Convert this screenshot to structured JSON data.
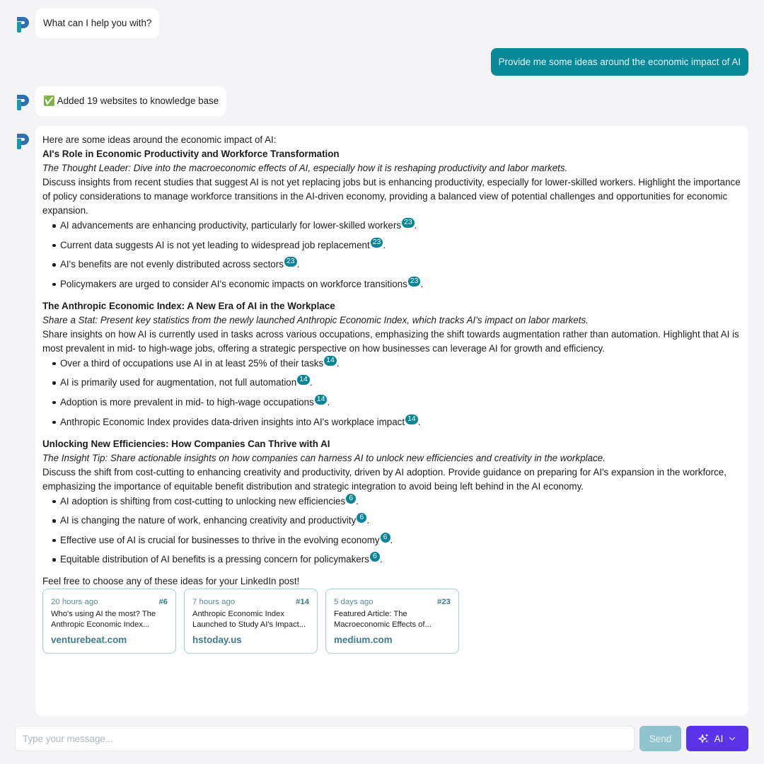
{
  "colors": {
    "background": "#f4f4f6",
    "user_bubble": "#08899a",
    "citation_badge": "#0a8496",
    "send_button": "#8fc3cd",
    "ai_button": "#5b34ea",
    "source_border": "#a9cdd5"
  },
  "assistant": {
    "avatar_icon": "p-logo-icon"
  },
  "messages": {
    "greeting": "What can I help you with?",
    "user_prompt": "Provide me some ideas around the economic impact of AI",
    "status": "✅ Added 19 websites to knowledge base",
    "response": {
      "intro": "Here are some ideas around the economic impact of AI:",
      "sections": [
        {
          "title": "AI's Role in Economic Productivity and Workforce Transformation",
          "italic": "The Thought Leader: Dive into the macroeconomic effects of AI, especially how it is reshaping productivity and labor markets.",
          "description": "Discuss insights from recent studies that suggest AI is not yet replacing jobs but is enhancing productivity, especially for lower-skilled workers. Highlight the importance of policy considerations to manage workforce transitions in the AI-driven economy, providing a balanced view of potential challenges and opportunities for economic expansion.",
          "points": [
            {
              "text": "AI advancements are enhancing productivity, particularly for lower-skilled workers",
              "cite": "23"
            },
            {
              "text": "Current data suggests AI is not yet leading to widespread job replacement",
              "cite": "23"
            },
            {
              "text": "AI's benefits are not evenly distributed across sectors",
              "cite": "23"
            },
            {
              "text": "Policymakers are urged to consider AI's economic impacts on workforce transitions",
              "cite": "23"
            }
          ]
        },
        {
          "title": "The Anthropic Economic Index: A New Era of AI in the Workplace",
          "italic": "Share a Stat: Present key statistics from the newly launched Anthropic Economic Index, which tracks AI's impact on labor markets.",
          "description": "Share insights on how AI is currently used in tasks across various occupations, emphasizing the shift towards augmentation rather than automation. Highlight that AI is most prevalent in mid- to high-wage jobs, offering a strategic perspective on how businesses can leverage AI for growth and efficiency.",
          "points": [
            {
              "text": "Over a third of occupations use AI in at least 25% of their tasks",
              "cite": "14"
            },
            {
              "text": "AI is primarily used for augmentation, not full automation",
              "cite": "14"
            },
            {
              "text": "Adoption is more prevalent in mid- to high-wage occupations",
              "cite": "14"
            },
            {
              "text": "Anthropic Economic Index provides data-driven insights into AI's workplace impact",
              "cite": "14"
            }
          ]
        },
        {
          "title": "Unlocking New Efficiencies: How Companies Can Thrive with AI",
          "italic": "The Insight Tip: Share actionable insights on how companies can harness AI to unlock new efficiencies and creativity in the workplace.",
          "description": "Discuss the shift from cost-cutting to enhancing creativity and productivity, driven by AI adoption. Provide guidance on preparing for AI's expansion in the workforce, emphasizing the importance of equitable benefit distribution and strategic integration to avoid being left behind in the AI economy.",
          "points": [
            {
              "text": "AI adoption is shifting from cost-cutting to unlocking new efficiencies",
              "cite": "6"
            },
            {
              "text": "AI is changing the nature of work, enhancing creativity and productivity",
              "cite": "6"
            },
            {
              "text": "Effective use of AI is crucial for businesses to thrive in the evolving economy",
              "cite": "6"
            },
            {
              "text": "Equitable distribution of AI benefits is a pressing concern for policymakers",
              "cite": "6"
            }
          ]
        }
      ],
      "outro": "Feel free to choose any of these ideas for your LinkedIn post!",
      "sources": [
        {
          "age": "20 hours ago",
          "num": "#6",
          "title": "Who's using AI the most? The Anthropic Economic Index...",
          "domain": "venturebeat.com"
        },
        {
          "age": "7 hours ago",
          "num": "#14",
          "title": "Anthropic Economic Index Launched to Study AI's Impact...",
          "domain": "hstoday.us"
        },
        {
          "age": "5 days ago",
          "num": "#23",
          "title": "Featured Article: The Macroeconomic Effects of...",
          "domain": "medium.com"
        }
      ]
    }
  },
  "composer": {
    "placeholder": "Type your message...",
    "value": "",
    "send_label": "Send",
    "ai_label": "AI",
    "ai_icon": "sparkles-icon",
    "ai_dropdown_icon": "chevron-down-icon"
  }
}
